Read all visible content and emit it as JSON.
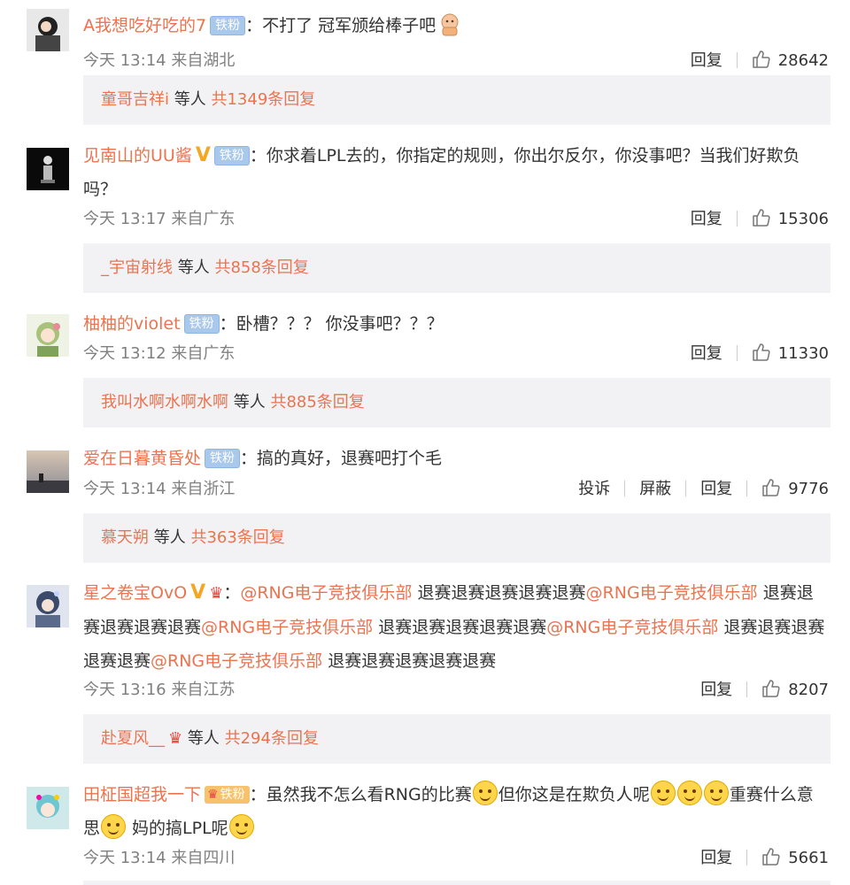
{
  "comments": [
    {
      "username": "A我想吃好吃的7",
      "badge": "铁粉",
      "text": "不打了 冠军颁给棒子吧",
      "time": "今天 13:14",
      "location": "来自湖北",
      "reply_label": "回复",
      "likes": "28642",
      "reply_preview": {
        "name": "童哥吉祥i",
        "mid": " 等人 ",
        "total": "共1349条回复"
      }
    },
    {
      "username": "见南山的UU酱",
      "verified": "V",
      "badge": "铁粉",
      "text": "你求着LPL去的，你指定的规则，你出尔反尔，你没事吧？当我们好欺负吗？",
      "time": "今天 13:17",
      "location": "来自广东",
      "reply_label": "回复",
      "likes": "15306",
      "reply_preview": {
        "name": "_宇宙射线",
        "mid": " 等人 ",
        "total": "共858条回复"
      }
    },
    {
      "username": "柚柚的violet",
      "badge": "铁粉",
      "text": "卧槽？？？ 你没事吧？？？",
      "time": "今天 13:12",
      "location": "来自广东",
      "reply_label": "回复",
      "likes": "11330",
      "reply_preview": {
        "name": "我叫水啊水啊水啊",
        "mid": " 等人 ",
        "total": "共885条回复"
      }
    },
    {
      "username": "爱在日暮黄昏处",
      "badge": "铁粉",
      "text": "搞的真好，退赛吧打个毛",
      "time": "今天 13:14",
      "location": "来自浙江",
      "report_label": "投诉",
      "block_label": "屏蔽",
      "reply_label": "回复",
      "likes": "9776",
      "reply_preview": {
        "name": "慕天朔",
        "mid": " 等人 ",
        "total": "共363条回复"
      }
    },
    {
      "username": "星之卷宝OvO",
      "verified": "V",
      "mention": "@RNG电子竞技俱乐部",
      "repeat_text": "退赛退赛退赛退赛退赛",
      "time": "今天 13:16",
      "location": "来自江苏",
      "reply_label": "回复",
      "likes": "8207",
      "reply_preview": {
        "name": "赴夏风__",
        "mid": " 等人 ",
        "total": "共294条回复"
      }
    },
    {
      "username": "田柾国超我一下",
      "badge": "铁粉",
      "text_a": "虽然我不怎么看RNG的比赛",
      "text_b": "但你这是在欺负人呢",
      "text_c": "重赛什么意思",
      "text_d": " 妈的搞LPL呢",
      "time": "今天 13:14",
      "location": "来自四川",
      "reply_label": "回复",
      "likes": "5661"
    }
  ],
  "colors": {
    "accent": "#eb7350",
    "meta": "#808080",
    "reply_bg": "#f2f2f5",
    "badge_bg": "#a9c9ec"
  },
  "icons": [
    "thumb-up-icon",
    "smile-emoji-icon",
    "baby-emoji-icon",
    "crown-icon",
    "verified-v-icon"
  ]
}
